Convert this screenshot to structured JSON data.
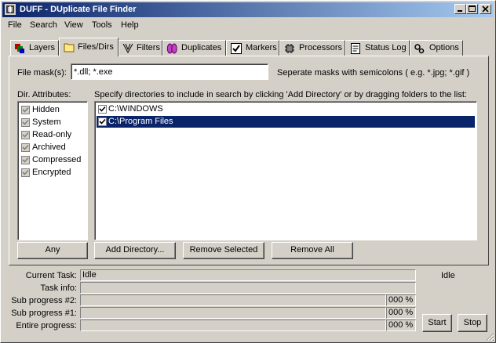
{
  "window": {
    "title": "DUFF - DUplicate File Finder"
  },
  "menu": [
    "File",
    "Search",
    "View",
    "Tools",
    "Help"
  ],
  "tabs": [
    {
      "label": "Layers",
      "icon": "layers-icon"
    },
    {
      "label": "Files/Dirs",
      "icon": "folder-icon",
      "active": true
    },
    {
      "label": "Filters",
      "icon": "filter-icon"
    },
    {
      "label": "Duplicates",
      "icon": "duplicates-icon"
    },
    {
      "label": "Markers",
      "icon": "checkbox-icon"
    },
    {
      "label": "Processors",
      "icon": "processor-icon"
    },
    {
      "label": "Status Log",
      "icon": "log-icon"
    },
    {
      "label": "Options",
      "icon": "options-icon"
    }
  ],
  "filesdirs": {
    "mask_label": "File mask(s):",
    "mask_value": "*.dll; *.exe",
    "mask_hint": "Seperate masks with semicolons ( e.g. *.jpg; *.gif )",
    "attr_label": "Dir. Attributes:",
    "attributes": [
      "Hidden",
      "System",
      "Read-only",
      "Archived",
      "Compressed",
      "Encrypted"
    ],
    "dirs_label": "Specify directories to include in search by clicking 'Add Directory' or by dragging folders to the list:",
    "directories": [
      {
        "path": "C:\\WINDOWS",
        "checked": true,
        "selected": false
      },
      {
        "path": "C:\\Program Files",
        "checked": true,
        "selected": true
      }
    ],
    "any_button": "Any",
    "add_button": "Add Directory...",
    "remove_selected_button": "Remove Selected",
    "remove_all_button": "Remove All"
  },
  "status": {
    "current_task_label": "Current Task:",
    "current_task_value": "Idle",
    "state_text": "Idle",
    "task_info_label": "Task info:",
    "task_info_value": "",
    "sub2_label": "Sub progress #2:",
    "sub2_pct": "000 %",
    "sub1_label": "Sub progress #1:",
    "sub1_pct": "000 %",
    "entire_label": "Entire progress:",
    "entire_pct": "000 %",
    "start_button": "Start",
    "stop_button": "Stop"
  },
  "colors": {
    "titlebar_start": "#0a246a",
    "titlebar_end": "#a6caf0",
    "selection": "#0a246a",
    "face": "#d4d0c8"
  }
}
